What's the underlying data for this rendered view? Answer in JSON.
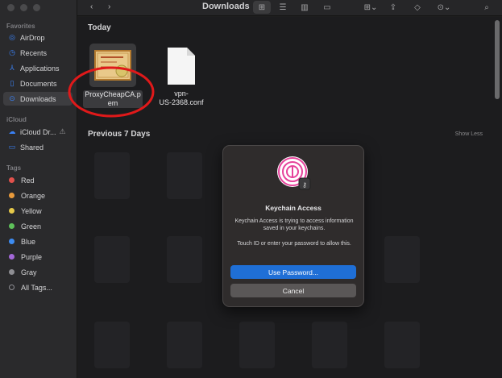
{
  "window": {
    "title": "Downloads"
  },
  "sidebar": {
    "favorites_label": "Favorites",
    "items": [
      {
        "label": "AirDrop",
        "icon": "airdrop-icon"
      },
      {
        "label": "Recents",
        "icon": "clock-icon"
      },
      {
        "label": "Applications",
        "icon": "applications-icon"
      },
      {
        "label": "Documents",
        "icon": "document-icon"
      },
      {
        "label": "Downloads",
        "icon": "downloads-icon",
        "active": true
      }
    ],
    "icloud_label": "iCloud",
    "icloud_items": [
      {
        "label": "iCloud Dr...",
        "icon": "cloud-icon"
      },
      {
        "label": "Shared",
        "icon": "shared-folder-icon"
      }
    ],
    "tags_label": "Tags",
    "tags": [
      {
        "label": "Red",
        "color": "#e2514c"
      },
      {
        "label": "Orange",
        "color": "#e99a3b"
      },
      {
        "label": "Yellow",
        "color": "#e6c94a"
      },
      {
        "label": "Green",
        "color": "#5ec15a"
      },
      {
        "label": "Blue",
        "color": "#3d8cf2"
      },
      {
        "label": "Purple",
        "color": "#a368d8"
      },
      {
        "label": "Gray",
        "color": "#8e8e93"
      },
      {
        "label": "All Tags...",
        "color": ""
      }
    ]
  },
  "content": {
    "today_label": "Today",
    "files": [
      {
        "name": "ProxyCheapCA.pem",
        "line1": "ProxyCheapCA.p",
        "line2": "em",
        "icon": "certificate-icon",
        "selected": true
      },
      {
        "name": "vpn-US-2368.conf",
        "line1": "vpn-",
        "line2": "US-2368.conf",
        "icon": "document-icon",
        "selected": false
      }
    ],
    "previous_label": "Previous 7 Days",
    "show_less": "Show Less"
  },
  "dialog": {
    "title": "Keychain Access",
    "message1": "Keychain Access is trying to access information saved in your keychains.",
    "message2": "Touch ID or enter your password to allow this.",
    "primary_button": "Use Password...",
    "secondary_button": "Cancel",
    "accent_color": "#1f6fd6"
  },
  "annotation": {
    "color": "#e0191a"
  }
}
